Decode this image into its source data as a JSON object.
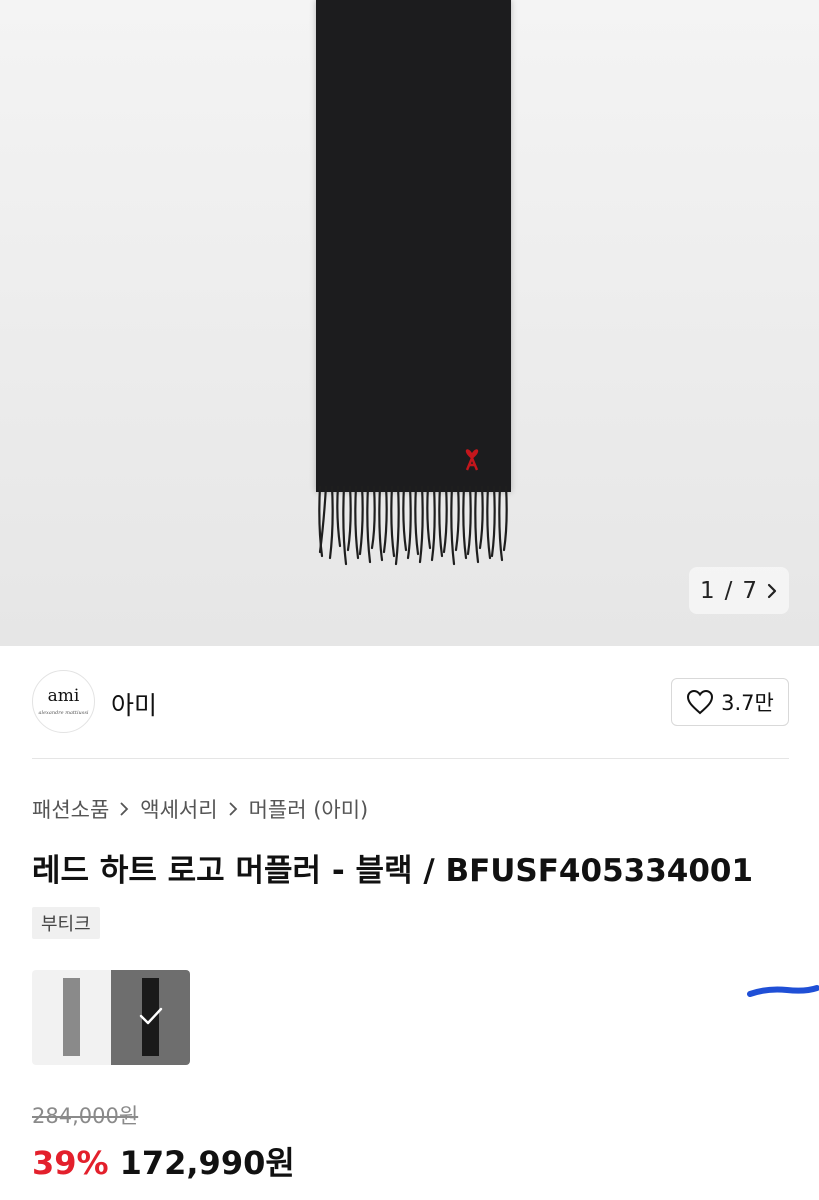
{
  "gallery": {
    "current": "1",
    "separator": "/",
    "total": "7",
    "next_icon": "chevron-right-icon"
  },
  "brand": {
    "logo_text": "ami",
    "logo_subtext": "alexandre mattiussi",
    "name": "아미",
    "likes": "3.7만",
    "like_icon": "heart-outline-icon"
  },
  "breadcrumb": {
    "items": [
      "패션소품",
      "액세서리",
      "머플러 (아미)"
    ],
    "separator_icon": "chevron-right-icon"
  },
  "product": {
    "title": "레드 하트 로고 머플러 - 블랙 / BFUSF405334001",
    "tag": "부티크"
  },
  "swatches": [
    {
      "color_name": "grey",
      "color": "#8a8a8a",
      "selected": false
    },
    {
      "color_name": "black",
      "color": "#1a1a1a",
      "selected": true
    }
  ],
  "price": {
    "original": "284,000원",
    "discount": "39%",
    "final": "172,990원"
  },
  "colors": {
    "discount": "#e3202c",
    "annotation": "#1f4fd6",
    "logo_red": "#c4161c"
  }
}
